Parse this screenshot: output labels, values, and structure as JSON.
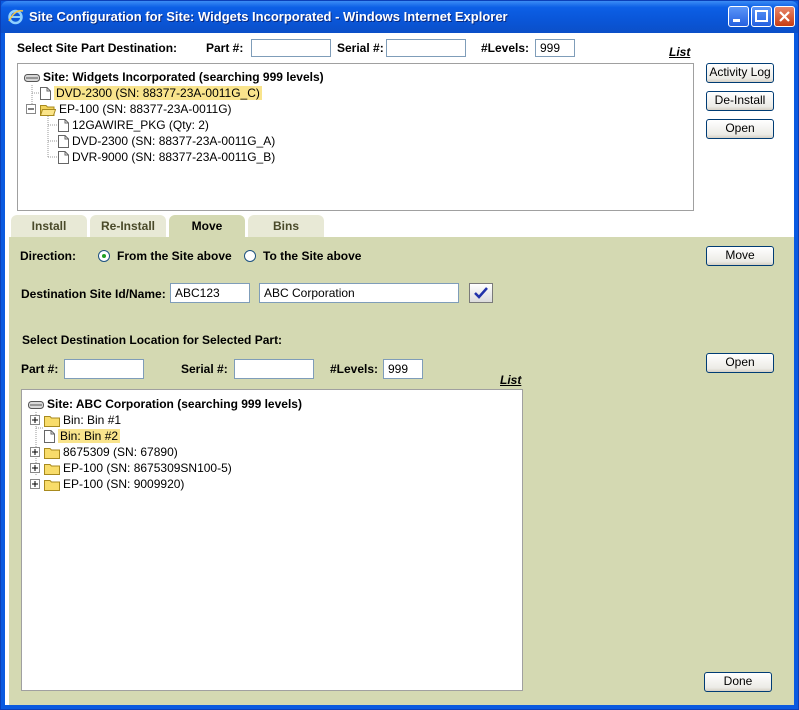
{
  "window": {
    "title": "Site Configuration for Site: Widgets Incorporated - Windows Internet Explorer"
  },
  "top": {
    "heading": "Select Site Part Destination:",
    "part_label": "Part #:",
    "part_value": "",
    "serial_label": "Serial #:",
    "serial_value": "",
    "levels_label": "#Levels:",
    "levels_value": "999",
    "list_link": "List",
    "tree": {
      "root": "Site: Widgets Incorporated (searching 999 levels)",
      "items": [
        "DVD-2300 (SN: 88377-23A-0011G_C)",
        "EP-100 (SN: 88377-23A-0011G)",
        "12GAWIRE_PKG (Qty: 2)",
        "DVD-2300 (SN: 88377-23A-0011G_A)",
        "DVR-9000 (SN: 88377-23A-0011G_B)"
      ]
    },
    "buttons": {
      "activity_log": "Activity Log",
      "de_install": "De-Install",
      "open": "Open"
    }
  },
  "tabs": [
    "Install",
    "Re-Install",
    "Move",
    "Bins"
  ],
  "move": {
    "direction_label": "Direction:",
    "from_label": "From the Site above",
    "to_label": "To the Site above",
    "move_button": "Move",
    "dest_label": "Destination Site Id/Name:",
    "dest_id": "ABC123",
    "dest_name": "ABC Corporation",
    "select_heading": "Select Destination Location for Selected Part:",
    "part_label": "Part #:",
    "part_value": "",
    "serial_label": "Serial #:",
    "serial_value": "",
    "levels_label": "#Levels:",
    "levels_value": "999",
    "list_link": "List",
    "open_button": "Open",
    "tree": {
      "root": "Site: ABC Corporation (searching 999 levels)",
      "items": [
        "Bin: Bin #1",
        "Bin: Bin #2",
        "8675309 (SN: 67890)",
        "EP-100 (SN: 8675309SN100-5)",
        "EP-100 (SN: 9009920)"
      ]
    },
    "done_button": "Done"
  }
}
